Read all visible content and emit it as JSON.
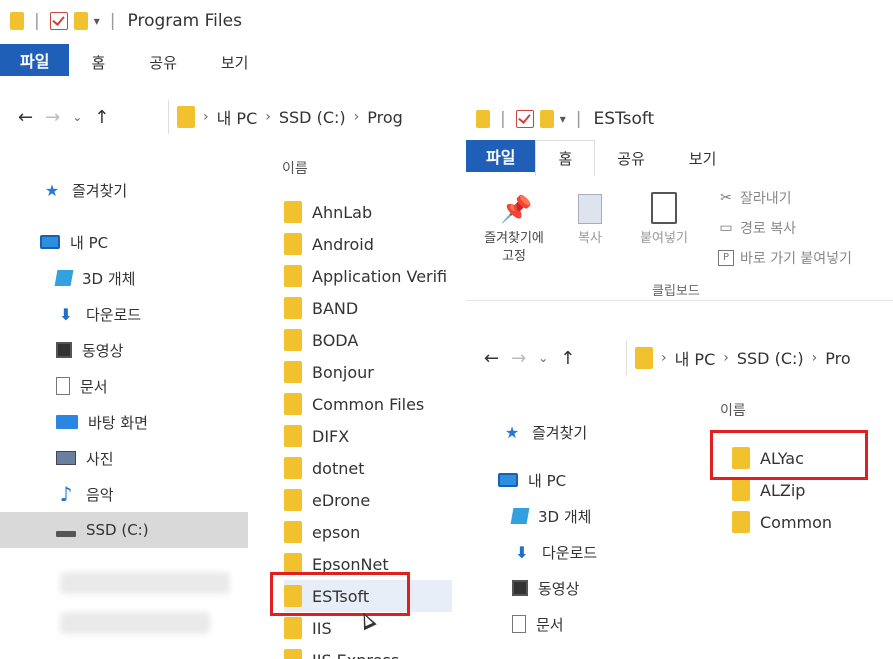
{
  "left": {
    "title": "Program Files",
    "ribbon_tabs": [
      "파일",
      "홈",
      "공유",
      "보기"
    ],
    "address": [
      "내 PC",
      "SSD (C:)",
      "Prog"
    ],
    "column_name": "이름",
    "nav": [
      {
        "label": "즐겨찾기",
        "icon": "star-icon"
      },
      {
        "label": "내 PC",
        "icon": "pc-icon"
      },
      {
        "label": "3D 개체",
        "icon": "3d-objects-icon"
      },
      {
        "label": "다운로드",
        "icon": "download-icon"
      },
      {
        "label": "동영상",
        "icon": "video-icon"
      },
      {
        "label": "문서",
        "icon": "document-icon"
      },
      {
        "label": "바탕 화면",
        "icon": "desktop-icon"
      },
      {
        "label": "사진",
        "icon": "pictures-icon"
      },
      {
        "label": "음악",
        "icon": "music-icon"
      },
      {
        "label": "SSD (C:)",
        "icon": "drive-icon"
      }
    ],
    "files": [
      "AhnLab",
      "Android",
      "Application Verifi",
      "BAND",
      "BODA",
      "Bonjour",
      "Common Files",
      "DIFX",
      "dotnet",
      "eDrone",
      "epson",
      "EpsonNet",
      "ESTsoft",
      "IIS",
      "IIS Express"
    ]
  },
  "right": {
    "title": "ESTsoft",
    "ribbon_tabs": [
      "파일",
      "홈",
      "공유",
      "보기"
    ],
    "ribbon": {
      "pin_line1": "즐겨찾기에",
      "pin_line2": "고정",
      "copy": "복사",
      "paste": "붙여넣기",
      "cut": "잘라내기",
      "copy_path": "경로 복사",
      "paste_shortcut": "바로 가기 붙여넣기",
      "group": "클립보드"
    },
    "address": [
      "내 PC",
      "SSD (C:)",
      "Pro"
    ],
    "column_name": "이름",
    "nav": [
      {
        "label": "즐겨찾기",
        "icon": "star-icon"
      },
      {
        "label": "내 PC",
        "icon": "pc-icon"
      },
      {
        "label": "3D 개체",
        "icon": "3d-objects-icon"
      },
      {
        "label": "다운로드",
        "icon": "download-icon"
      },
      {
        "label": "동영상",
        "icon": "video-icon"
      },
      {
        "label": "문서",
        "icon": "document-icon"
      }
    ],
    "files": [
      "ALYac",
      "ALZip",
      "Common"
    ]
  },
  "colors": {
    "file_tab": "#1f5fb8",
    "folder": "#f2c12e",
    "highlight": "#e02020"
  }
}
